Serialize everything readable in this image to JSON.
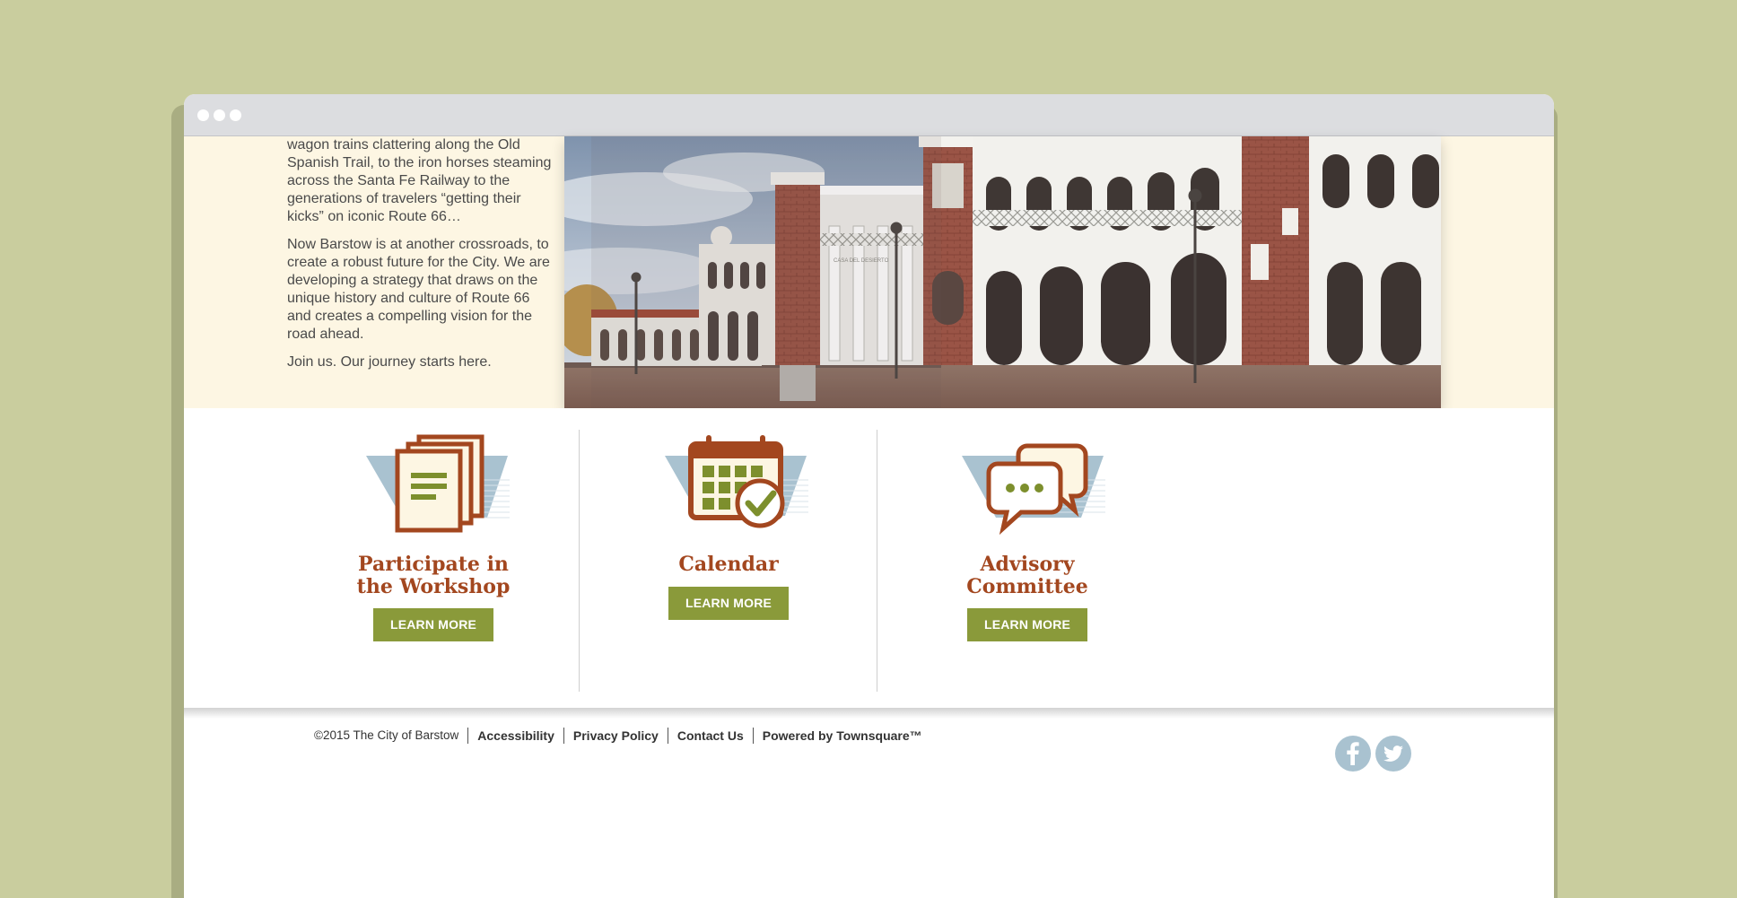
{
  "window": {
    "controls": [
      "close",
      "minimize",
      "maximize"
    ]
  },
  "intro": {
    "paragraph_1": "wagon trains clattering along the Old Spanish Trail, to the iron horses steaming across the Santa Fe Railway to the generations of travelers “getting their kicks” on iconic Route 66…",
    "paragraph_2": "Now Barstow is at another crossroads, to create a robust future for the City. We are developing a strategy that draws on the unique history and culture of Route 66 and creates a compelling vision for the road ahead.",
    "paragraph_3": "Join us. Our journey starts here."
  },
  "hero_image": {
    "subject": "historic-railway-depot-photo",
    "sign_text": "CASA DEL DESIERTO"
  },
  "cards": [
    {
      "icon": "documents-icon",
      "title_line1": "Participate in",
      "title_line2": "the Workshop",
      "button": "LEARN MORE"
    },
    {
      "icon": "calendar-icon",
      "title_line1": "Calendar",
      "title_line2": "",
      "button": "LEARN MORE"
    },
    {
      "icon": "chat-bubbles-icon",
      "title_line1": "Advisory",
      "title_line2": "Committee",
      "button": "LEARN MORE"
    }
  ],
  "footer": {
    "copyright": "©2015 The City of Barstow",
    "links": [
      "Accessibility",
      "Privacy Policy",
      "Contact Us",
      "Powered by Townsquare™"
    ],
    "social": [
      "facebook-icon",
      "twitter-icon"
    ]
  },
  "colors": {
    "background": "#c9cd9e",
    "hero_bg": "#fdf6e3",
    "title_rust": "#a3471f",
    "button_olive": "#8a9a3a",
    "icon_blue": "#a9c2d0",
    "icon_green": "#7d8f2d"
  }
}
